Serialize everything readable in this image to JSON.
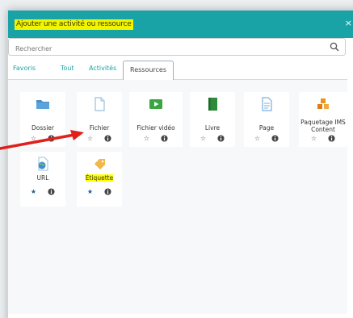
{
  "modal": {
    "title": "Ajouter une activité ou ressource",
    "close_symbol": "×"
  },
  "search": {
    "placeholder": "Rechercher"
  },
  "tabs": [
    {
      "label": "Favoris",
      "active": false
    },
    {
      "label": "Tout",
      "active": false
    },
    {
      "label": "Activités",
      "active": false
    },
    {
      "label": "Ressources",
      "active": true
    }
  ],
  "resources": [
    {
      "label_line1": "Dossier",
      "label_line2": "",
      "icon": "folder-icon",
      "favorite": false
    },
    {
      "label_line1": "Fichier",
      "label_line2": "",
      "icon": "file-icon",
      "favorite": false
    },
    {
      "label_line1": "Fichier vidéo",
      "label_line2": "",
      "icon": "video-icon",
      "favorite": false
    },
    {
      "label_line1": "Livre",
      "label_line2": "",
      "icon": "book-icon",
      "favorite": false
    },
    {
      "label_line1": "Page",
      "label_line2": "",
      "icon": "page-icon",
      "favorite": false
    },
    {
      "label_line1": "Paquetage IMS",
      "label_line2": "Content",
      "icon": "package-icon",
      "favorite": false
    },
    {
      "label_line1": "URL",
      "label_line2": "",
      "icon": "url-icon",
      "favorite": true
    },
    {
      "label_line1": "Étiquette",
      "label_line2": "",
      "icon": "label-tag-icon",
      "favorite": true,
      "highlighted": true
    }
  ],
  "glyphs": {
    "star_empty": "☆",
    "star_filled": "★"
  },
  "colors": {
    "header": "#1aa3a6",
    "highlight": "#ffff00",
    "arrow": "#e0201b",
    "favorite_star": "#1f5f8b"
  }
}
